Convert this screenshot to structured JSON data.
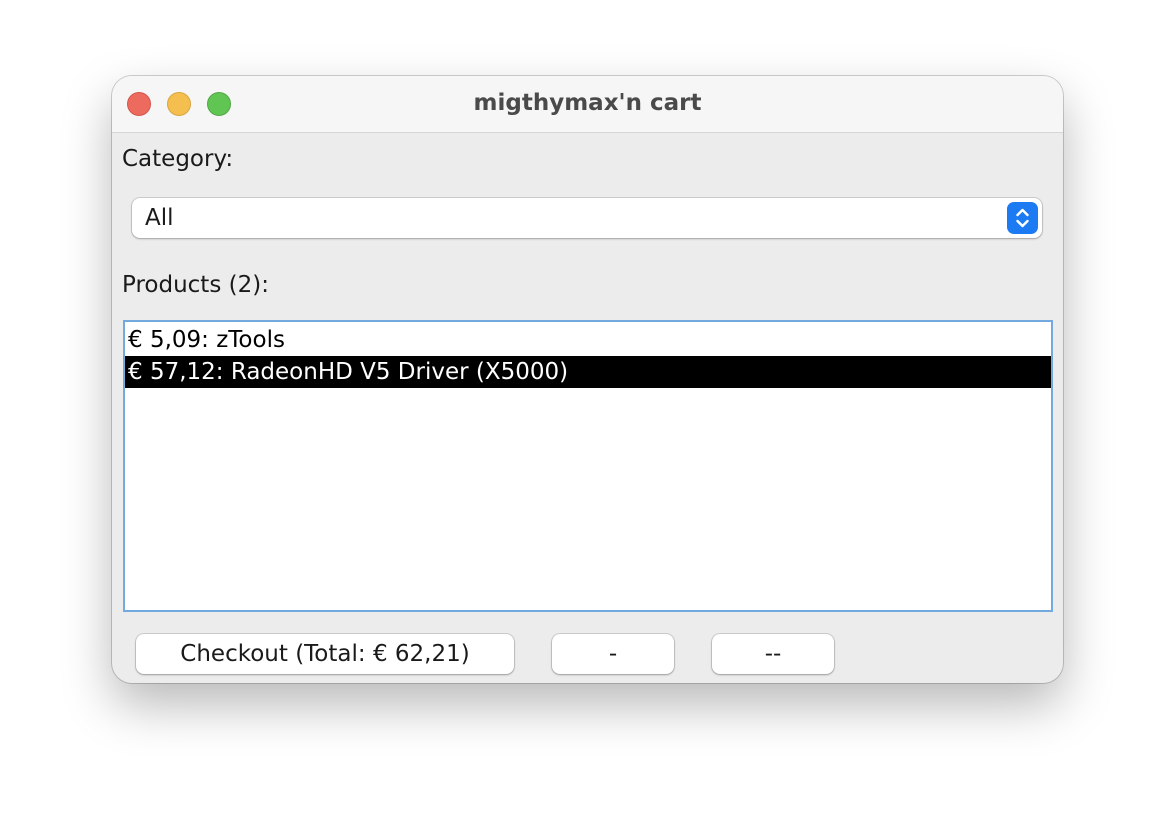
{
  "window": {
    "title": "migthymax'n cart"
  },
  "category": {
    "label": "Category:",
    "selected": "All",
    "stepper_icon": "up-down-chevron-icon"
  },
  "products": {
    "label": "Products (2):",
    "items": [
      {
        "text": "€ 5,09: zTools",
        "selected": false
      },
      {
        "text": "€ 57,12: RadeonHD V5 Driver (X5000)",
        "selected": true
      }
    ]
  },
  "buttons": {
    "checkout_label": "Checkout (Total: € 62,21)",
    "remove_label": "-",
    "remove_all_label": "--"
  },
  "colors": {
    "accent": "#1c7bf2",
    "selection": "#000000",
    "focus_border": "#74a9e0"
  }
}
